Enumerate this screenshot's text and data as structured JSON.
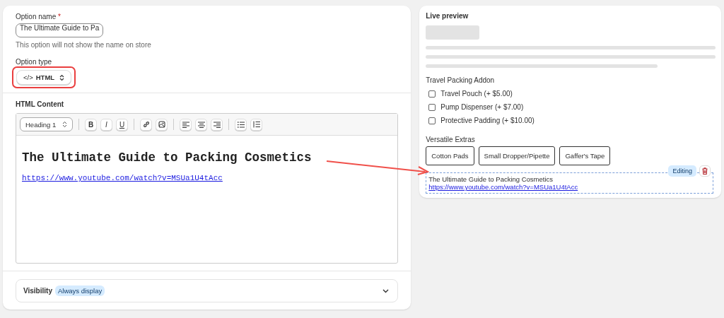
{
  "option_form": {
    "name_label": "Option name",
    "required_mark": "*",
    "name_value": "The Ultimate Guide to Pa",
    "name_help": "This option will not show the name on store",
    "type_label": "Option type",
    "type_icon": "</>",
    "type_value": "HTML",
    "type_highlighted": true
  },
  "html_content": {
    "title": "HTML Content",
    "block_format": "Heading 1",
    "format_buttons": [
      {
        "label": "B",
        "kind": "bold"
      },
      {
        "label": "I",
        "kind": "italic"
      },
      {
        "label": "U",
        "kind": "underline"
      }
    ],
    "heading": "The Ultimate Guide to Packing Cosmetics",
    "link": "https://www.youtube.com/watch?v=MSUa1U4tAcc"
  },
  "visibility": {
    "label": "Visibility",
    "badge": "Always display",
    "expanded": false
  },
  "live_preview": {
    "title": "Live preview",
    "groups": [
      {
        "kind": "checkbox",
        "title": "Travel Packing Addon",
        "options": [
          {
            "label": "Travel Pouch (+ $5.00)",
            "checked": false
          },
          {
            "label": "Pump Dispenser (+ $7.00)",
            "checked": false
          },
          {
            "label": "Protective Padding (+ $10.00)",
            "checked": false
          }
        ]
      },
      {
        "kind": "button",
        "title": "Versatile Extras",
        "options": [
          {
            "label": "Cotton Pads"
          },
          {
            "label": "Small Dropper/Pipette"
          },
          {
            "label": "Gaffer's Tape"
          }
        ]
      }
    ],
    "html_block": {
      "heading": "The Ultimate Guide to Packing Cosmetics",
      "link": "https://www.youtube.com/watch?v=MSUa1U4tAcc",
      "status": "Editing"
    }
  }
}
